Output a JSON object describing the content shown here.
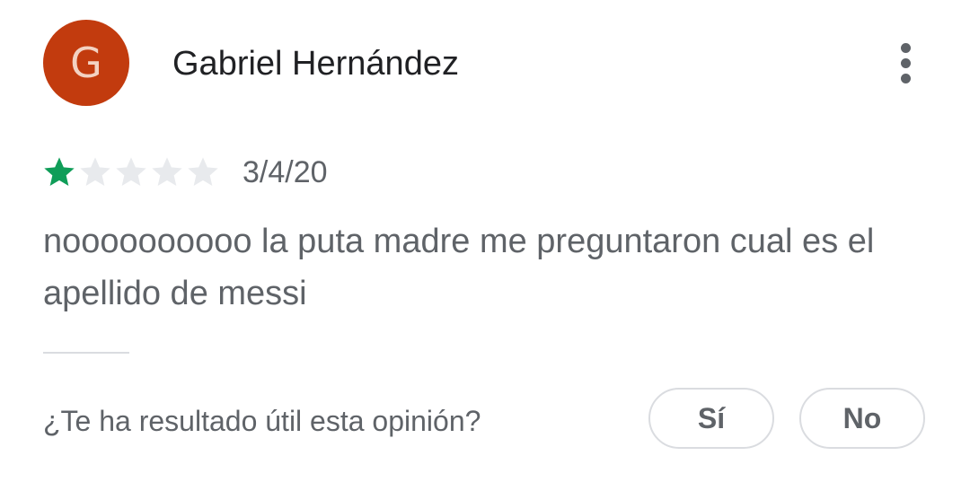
{
  "review": {
    "author": {
      "initial": "G",
      "name": "Gabriel Hernández",
      "avatar_color": "#c23b0e"
    },
    "more_icon": "more-vert-icon",
    "rating": {
      "value": 1,
      "max": 5,
      "filled_color": "#0f9d58",
      "empty_color": "#e8eaed"
    },
    "date": "3/4/20",
    "text": "noooooooooo la puta madre me preguntaron cual es el apellido de messi"
  },
  "helpful": {
    "question": "¿Te ha resultado útil esta opinión?",
    "yes_label": "Sí",
    "no_label": "No"
  }
}
